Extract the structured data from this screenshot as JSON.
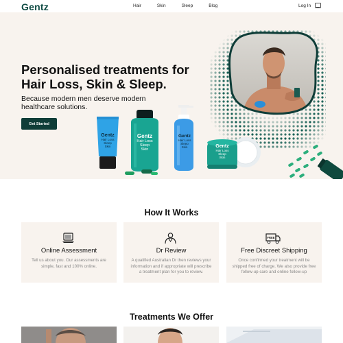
{
  "nav": {
    "logo": "Gentz",
    "links": [
      "Hair",
      "Skin",
      "Sleep",
      "Blog"
    ],
    "login": "Log In"
  },
  "hero": {
    "title_line1": "Personalised treatments for",
    "title_line2": "Hair Loss, Skin & Sleep.",
    "subtitle_line1": "Because modern men deserve modern",
    "subtitle_line2": "healthcare solutions.",
    "cta": "Get Started"
  },
  "products": [
    {
      "brand": "Gentz",
      "lines": [
        "Hair Loss",
        "Sleep",
        "Skin"
      ]
    },
    {
      "brand": "Gentz",
      "lines": [
        "Hair Loss",
        "Sleep",
        "Skin"
      ]
    },
    {
      "brand": "Gentz",
      "lines": [
        "Hair Loss",
        "Sleep",
        "Skin"
      ]
    },
    {
      "brand": "Gentz",
      "lines": [
        "Hair Loss",
        "Sleep",
        "Skin"
      ]
    }
  ],
  "how_it_works": {
    "title": "How It Works",
    "cards": [
      {
        "icon": "laptop-icon",
        "title": "Online Assessment",
        "text": "Tell us about you. Our assessments are simple, fast and 100% online."
      },
      {
        "icon": "doctor-icon",
        "title": "Dr Review",
        "text": "A qualified Australian Dr then reviews your information and if appropriate will prescribe a treatment plan for you to review."
      },
      {
        "icon": "free-truck-icon",
        "badge": "FREE",
        "title": "Free Discreet Shipping",
        "text": "Once confirmed your treatment will be shipped free of charge. We also provide free follow-up care and online follow-up"
      }
    ]
  },
  "treatments": {
    "title": "Treatments We Offer"
  },
  "colors": {
    "brand": "#0d4a42",
    "hero_bg": "#f8f3ee",
    "teal": "#1fae9a",
    "blue": "#2a8fd8"
  }
}
